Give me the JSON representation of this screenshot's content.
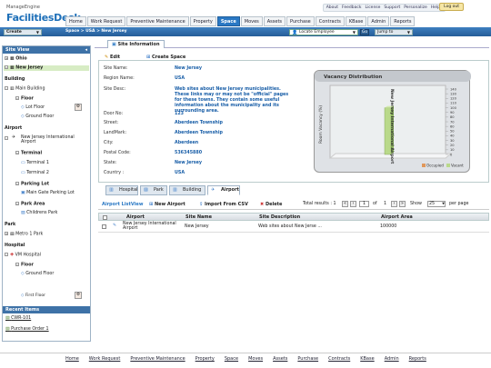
{
  "brand": {
    "line1": "ManageEngine",
    "line2": "FacilitiesDesk"
  },
  "top_links": [
    "About",
    "Feedback",
    "License",
    "Support",
    "Personalize",
    "Help"
  ],
  "logout_label": "Log out",
  "nav": [
    "Home",
    "Work Request",
    "Preventive Maintenance",
    "Property",
    "Space",
    "Moves",
    "Assets",
    "Purchase",
    "Contracts",
    "KBase",
    "Admin",
    "Reports"
  ],
  "nav_active": "Space",
  "actionbar": {
    "create_label": "Create",
    "breadcrumb": "Space  >  USA  >  New Jersey",
    "locate_label": "Locate Employee",
    "go_label": "Go",
    "jump_label": "Jump to"
  },
  "sidebar": {
    "title": "Site View",
    "tree": {
      "ohio": "Ohio",
      "new_jersey": "New Jersey",
      "building": "Building",
      "main_building": "Main Building",
      "floor": "Floor",
      "lot_floor": "Lot Floor",
      "ground_floor": "Ground Floor",
      "airport": "Airport",
      "nj_airport": "New Jersey International Airport",
      "terminal": "Terminal",
      "terminal1": "Terminal 1",
      "terminal2": "Terminal 2",
      "parking_lot": "Parking Lot",
      "main_gate": "Main Gate Parking Lot",
      "park_area": "Park Area",
      "childrens_park": "Childrens Park",
      "park": "Park",
      "metro_park": "Metro 1 Park",
      "hospital": "Hospital",
      "vm_hospital": "VM Hospital",
      "floor2": "Floor",
      "ground_floor2": "Ground Floor",
      "first_floor": "First Floor"
    },
    "recent_title": "Recent Items",
    "recent": [
      "CWR-101",
      "Purchase Order 1"
    ]
  },
  "site_info": {
    "tab_label": "Site Information",
    "edit_label": "Edit",
    "create_space_label": "Create Space",
    "fields": [
      {
        "label": "Site Name:",
        "value": "New Jersey"
      },
      {
        "label": "Region Name:",
        "value": "USA"
      },
      {
        "label": "Site Desc:",
        "value": "Web sites about New Jersey municipalities. These links may or may not be \"official\" pages for these towns. They contain some useful information about the municipality and its surrounding area."
      },
      {
        "label": "Door No:",
        "value": "123"
      },
      {
        "label": "Street:",
        "value": "Aberdeen Township"
      },
      {
        "label": "LandMark:",
        "value": "Aberdeen Township"
      },
      {
        "label": "City:",
        "value": "Aberdeen"
      },
      {
        "label": "Postal Code:",
        "value": "536345880"
      },
      {
        "label": "State:",
        "value": "New Jersey"
      },
      {
        "label": "Country :",
        "value": "USA"
      }
    ]
  },
  "chart_data": {
    "type": "bar",
    "title": "Vacancy Distribution",
    "ylabel": "Room Vacancy (%)",
    "categories": [
      "New Jersey International Airport"
    ],
    "series": [
      {
        "name": "Occupied",
        "values": [
          0
        ],
        "color": "#e0975a"
      },
      {
        "name": "Vacant",
        "values": [
          100
        ],
        "color": "#b9d98a"
      }
    ],
    "yticks": [
      "0",
      "10",
      "20",
      "30",
      "40",
      "50",
      "60",
      "70",
      "80",
      "90",
      "100",
      "110",
      "120",
      "130",
      "140"
    ],
    "ylim": [
      0,
      140
    ]
  },
  "subtabs": [
    {
      "label": "Hospital",
      "active": false
    },
    {
      "label": "Park",
      "active": false
    },
    {
      "label": "Building",
      "active": false
    },
    {
      "label": "Airport",
      "active": true
    }
  ],
  "listview": {
    "title": "Airport ListView",
    "new_airport": "New Airport",
    "import_csv": "Import From CSV",
    "delete_label": "Delete",
    "total_label": "Total results : 1",
    "page_current": "1",
    "page_of": "of",
    "page_total": "1",
    "show_label": "Show",
    "per_page_value": "25",
    "per_page_label": "per page",
    "columns": [
      "Airport",
      "Site Name",
      "Site Description",
      "Airport Area"
    ],
    "rows": [
      {
        "airport": "New Jersey International Airport",
        "site_name": "New Jersey",
        "description": "Web sites about New Jerse ...",
        "area": "100000"
      }
    ]
  },
  "footer": [
    "Home",
    "Work Request",
    "Preventive Maintenance",
    "Property",
    "Space",
    "Moves",
    "Assets",
    "Purchase",
    "Contracts",
    "KBase",
    "Admin",
    "Reports"
  ]
}
